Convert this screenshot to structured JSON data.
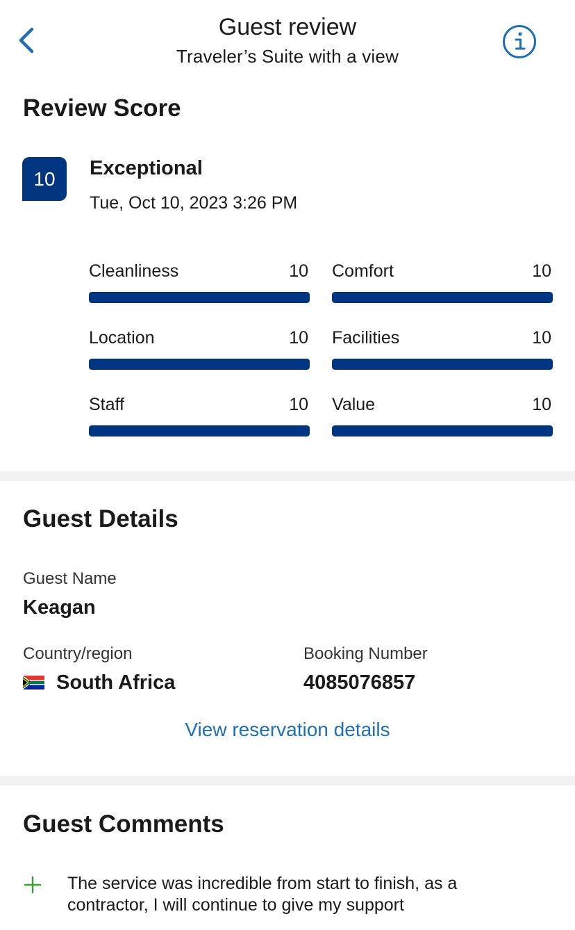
{
  "header": {
    "title": "Guest review",
    "subtitle": "Traveler’s Suite with a view",
    "back_icon": "chevron-left-icon",
    "info_icon": "info-circle-icon"
  },
  "review_score": {
    "section_title": "Review Score",
    "score": "10",
    "score_word": "Exceptional",
    "date": "Tue, Oct 10, 2023 3:26 PM",
    "categories": [
      {
        "label": "Cleanliness",
        "value": "10",
        "fill": 1.0
      },
      {
        "label": "Comfort",
        "value": "10",
        "fill": 1.0
      },
      {
        "label": "Location",
        "value": "10",
        "fill": 1.0
      },
      {
        "label": "Facilities",
        "value": "10",
        "fill": 1.0
      },
      {
        "label": "Staff",
        "value": "10",
        "fill": 1.0
      },
      {
        "label": "Value",
        "value": "10",
        "fill": 1.0
      }
    ]
  },
  "guest_details": {
    "section_title": "Guest Details",
    "guest_name_label": "Guest Name",
    "guest_name": "Keagan",
    "country_label": "Country/region",
    "country": "South Africa",
    "country_flag_icon": "south-africa-flag-icon",
    "booking_label": "Booking Number",
    "booking_number": "4085076857",
    "reservation_link": "View reservation details"
  },
  "guest_comments": {
    "section_title": "Guest Comments",
    "positive_icon": "plus-icon",
    "positive_comment": "The service was incredible from start to finish, as a contractor, I will continue to give my support"
  },
  "colors": {
    "brand_blue": "#003580",
    "link_blue": "#1f6fb5",
    "positive_green": "#3b9e3b",
    "divider_gray": "#f2f2f2"
  }
}
